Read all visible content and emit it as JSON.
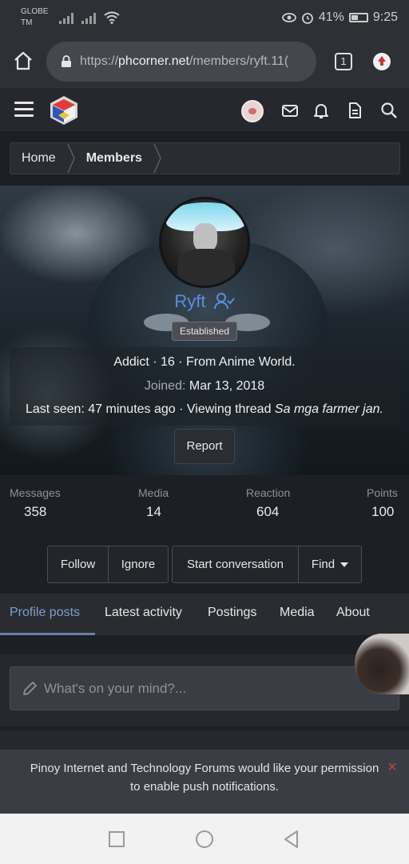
{
  "status_bar": {
    "carrier_line1": "GLOBE",
    "carrier_line2": "TM",
    "battery_percent": "41%",
    "time": "9:25",
    "icons": [
      "signal-icon",
      "wifi-icon",
      "eye-icon",
      "alarm-icon",
      "battery-icon"
    ]
  },
  "browser": {
    "url_prefix": "https://",
    "url_host": "phcorner.net",
    "url_path": "/members/ryft.11(",
    "tab_count": "1",
    "icons": [
      "home-icon",
      "lock-icon",
      "update-icon"
    ]
  },
  "site_header": {
    "icons": [
      "menu-icon",
      "site-logo",
      "user-avatar",
      "mail-icon",
      "bell-icon",
      "document-icon",
      "search-icon"
    ]
  },
  "breadcrumb": {
    "items": [
      "Home",
      "Members"
    ]
  },
  "profile": {
    "username": "Ryft",
    "title_badge": "Established",
    "line1": "Addict · 16 · From Anime World.",
    "joined_label": "Joined:",
    "joined_date": "Mar 13, 2018",
    "last_seen_label": "Last seen:",
    "last_seen_value": "47 minutes ago · Viewing thread",
    "last_seen_thread": "Sa mga farmer jan.",
    "report_label": "Report"
  },
  "stats": [
    {
      "label": "Messages",
      "value": "358"
    },
    {
      "label": "Media",
      "value": "14"
    },
    {
      "label": "Reaction",
      "value": "604"
    },
    {
      "label": "Points",
      "value": "100"
    }
  ],
  "actions": {
    "follow": "Follow",
    "ignore": "Ignore",
    "start_conversation": "Start conversation",
    "find": "Find"
  },
  "tabs": [
    {
      "label": "Profile posts",
      "active": true
    },
    {
      "label": "Latest activity",
      "active": false
    },
    {
      "label": "Postings",
      "active": false
    },
    {
      "label": "Media",
      "active": false
    },
    {
      "label": "About",
      "active": false
    }
  ],
  "compose": {
    "placeholder": "What's on your mind?..."
  },
  "push_notice": {
    "line1": "Pinoy Internet and Technology Forums would like your permission",
    "line2": "to enable push notifications.",
    "close": "×"
  },
  "colors": {
    "accent_link": "#5a8ee0",
    "active_tab": "#7d9fcf",
    "close_red": "#c0444a"
  }
}
